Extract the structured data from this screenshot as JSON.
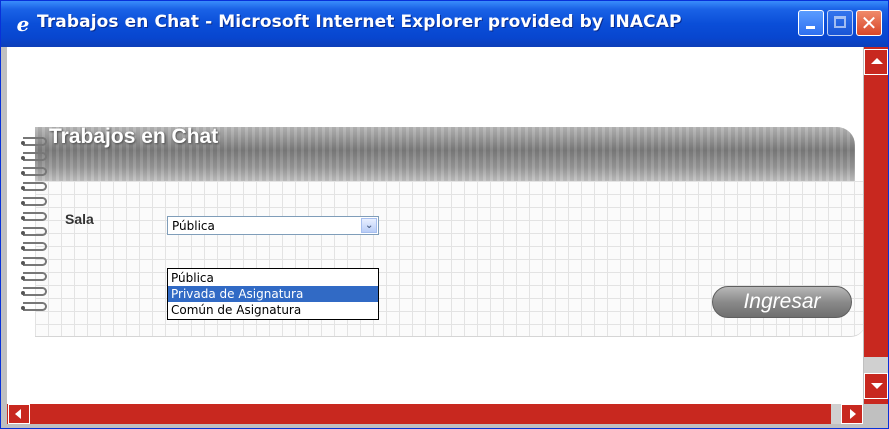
{
  "window": {
    "title": "Trabajos en Chat - Microsoft Internet Explorer provided by INACAP",
    "icon": "ie-icon",
    "accent": "#0a4ed8"
  },
  "page": {
    "title": "Trabajos en Chat",
    "sala_label": "Sala",
    "select_value": "Pública",
    "options": [
      "Pública",
      "Privada de Asignatura",
      "Común de Asignatura"
    ],
    "selected_option": "Privada de Asignatura",
    "submit_label": "Ingresar"
  },
  "colors": {
    "scrollbar": "#c8281f",
    "selection": "#316ac5"
  }
}
